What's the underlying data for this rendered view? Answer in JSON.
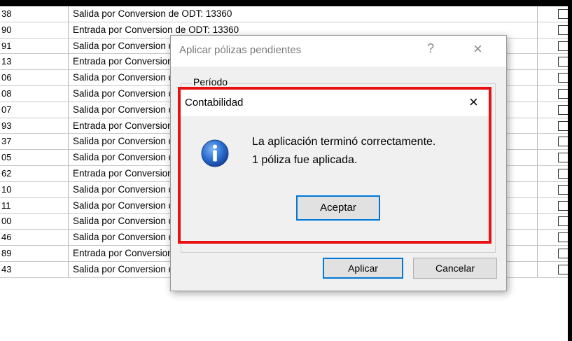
{
  "grid": {
    "rows": [
      {
        "id": "38",
        "desc": "Salida por Conversion de ODT: 13360"
      },
      {
        "id": "90",
        "desc": "Entrada por Conversion de ODT: 13360"
      },
      {
        "id": "91",
        "desc": "Salida por Conversion de ODT: 13360"
      },
      {
        "id": "13",
        "desc": "Entrada por Conversion de ODT"
      },
      {
        "id": "06",
        "desc": "Salida por Conversion de ODT"
      },
      {
        "id": "08",
        "desc": "Salida por Conversion de ODT"
      },
      {
        "id": "07",
        "desc": "Salida por Conversion de ODT"
      },
      {
        "id": "93",
        "desc": "Entrada por Conversion de ODT"
      },
      {
        "id": "37",
        "desc": "Salida por Conversion de ODT"
      },
      {
        "id": "05",
        "desc": "Salida por Conversion de ODT"
      },
      {
        "id": "62",
        "desc": "Entrada por Conversion de ODT"
      },
      {
        "id": "10",
        "desc": "Salida por Conversion de ODT"
      },
      {
        "id": "11",
        "desc": "Salida por Conversion de ODT"
      },
      {
        "id": "00",
        "desc": "Salida por Conversion de ODT"
      },
      {
        "id": "46",
        "desc": "Salida por Conversion de ODT: 13391"
      },
      {
        "id": "89",
        "desc": "Entrada por Conversion de ODT: 13359"
      },
      {
        "id": "43",
        "desc": "Salida por Conversion de ODT: 13420"
      }
    ]
  },
  "dialog_outer": {
    "title": "Aplicar pólizas pendientes",
    "help": "?",
    "close": "×",
    "group_label": "Período",
    "apply_label": "Aplicar",
    "cancel_label": "Cancelar"
  },
  "dialog_inner": {
    "title": "Contabilidad",
    "close": "×",
    "message_line1": "La aplicación terminó correctamente.",
    "message_line2": "1 póliza fue aplicada.",
    "ok_label": "Aceptar",
    "icon": "info-icon"
  },
  "colors": {
    "highlight_border": "#e81010",
    "default_button_border": "#0078d7",
    "info_icon_blue": "#1f5fbf"
  }
}
